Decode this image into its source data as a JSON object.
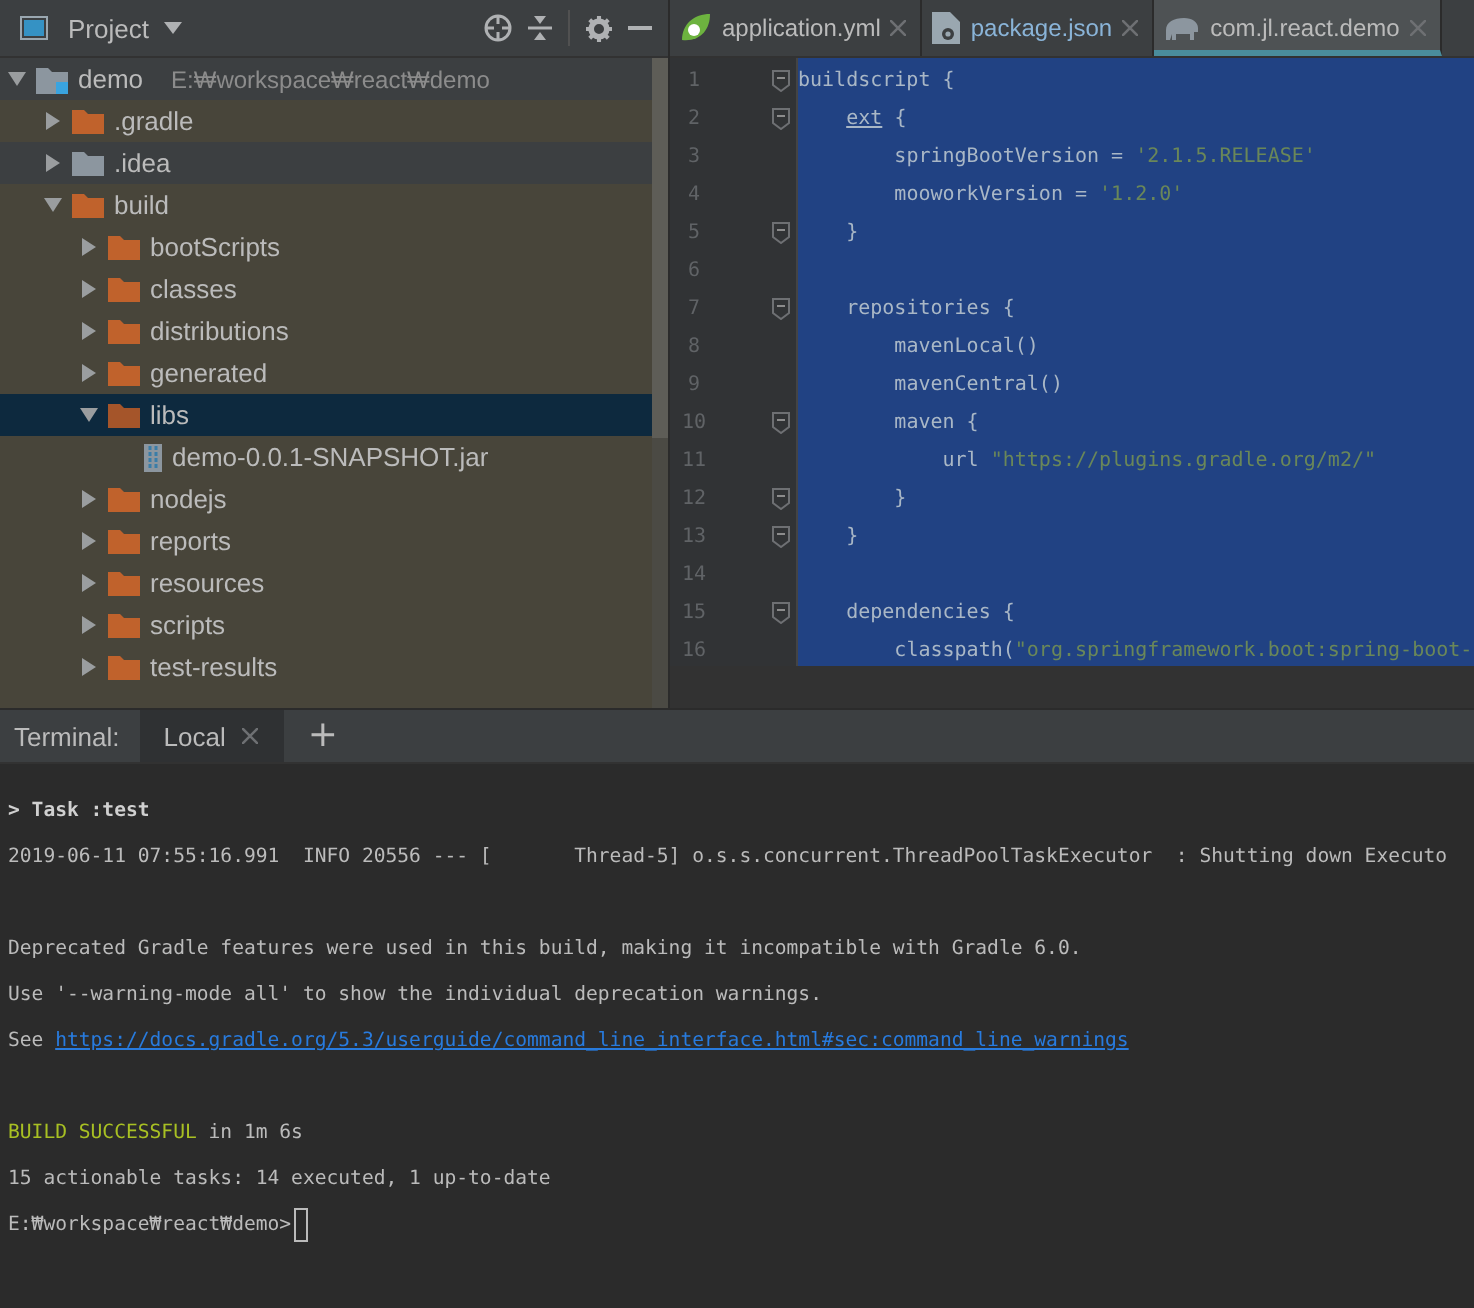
{
  "project": {
    "title": "Project",
    "tree": [
      {
        "name": "demo",
        "path": "E:₩workspace₩react₩demo",
        "kind": "module",
        "expanded": true,
        "excluded": false,
        "selected": false,
        "children": [
          {
            "name": ".gradle",
            "kind": "folder",
            "expanded": false,
            "excluded": true,
            "selected": false
          },
          {
            "name": ".idea",
            "kind": "folder",
            "expanded": false,
            "excluded": false,
            "selected": false
          },
          {
            "name": "build",
            "kind": "folder",
            "expanded": true,
            "excluded": true,
            "selected": false,
            "children": [
              {
                "name": "bootScripts",
                "kind": "folder",
                "expanded": false,
                "excluded": true,
                "selected": false
              },
              {
                "name": "classes",
                "kind": "folder",
                "expanded": false,
                "excluded": true,
                "selected": false
              },
              {
                "name": "distributions",
                "kind": "folder",
                "expanded": false,
                "excluded": true,
                "selected": false
              },
              {
                "name": "generated",
                "kind": "folder",
                "expanded": false,
                "excluded": true,
                "selected": false
              },
              {
                "name": "libs",
                "kind": "folder",
                "expanded": true,
                "excluded": true,
                "selected": true,
                "children": [
                  {
                    "name": "demo-0.0.1-SNAPSHOT.jar",
                    "kind": "jar",
                    "excluded": true,
                    "selected": false
                  }
                ]
              },
              {
                "name": "nodejs",
                "kind": "folder",
                "expanded": false,
                "excluded": true,
                "selected": false
              },
              {
                "name": "reports",
                "kind": "folder",
                "expanded": false,
                "excluded": true,
                "selected": false
              },
              {
                "name": "resources",
                "kind": "folder",
                "expanded": false,
                "excluded": true,
                "selected": false
              },
              {
                "name": "scripts",
                "kind": "folder",
                "expanded": false,
                "excluded": true,
                "selected": false
              },
              {
                "name": "test-results",
                "kind": "folder",
                "expanded": false,
                "excluded": true,
                "selected": false
              }
            ]
          }
        ]
      }
    ]
  },
  "editor": {
    "tabs": [
      {
        "label": "application.yml",
        "kind": "spring",
        "selected": false
      },
      {
        "label": "package.json",
        "kind": "file",
        "selected": false
      },
      {
        "label": "com.jl.react.demo",
        "kind": "gradle",
        "selected": true
      }
    ],
    "lines": [
      {
        "number": "1",
        "fold": true,
        "segments": [
          {
            "kind": "plain",
            "text": "buildscript {"
          }
        ]
      },
      {
        "number": "2",
        "fold": true,
        "segments": [
          {
            "kind": "link",
            "text": "    ext"
          },
          {
            "kind": "plain",
            "text": " {"
          }
        ]
      },
      {
        "number": "3",
        "fold": false,
        "segments": [
          {
            "kind": "plain",
            "text": "        springBootVersion = "
          },
          {
            "kind": "string",
            "text": "'2.1.5.RELEASE'"
          }
        ]
      },
      {
        "number": "4",
        "fold": false,
        "segments": [
          {
            "kind": "plain",
            "text": "        mooworkVersion = "
          },
          {
            "kind": "string",
            "text": "'1.2.0'"
          }
        ]
      },
      {
        "number": "5",
        "fold": true,
        "segments": [
          {
            "kind": "plain",
            "text": "    }"
          }
        ]
      },
      {
        "number": "6",
        "fold": false
      },
      {
        "number": "7",
        "fold": true,
        "segments": [
          {
            "kind": "plain",
            "text": "    repositories {"
          }
        ]
      },
      {
        "number": "8",
        "fold": false,
        "segments": [
          {
            "kind": "plain",
            "text": "        mavenLocal()"
          }
        ]
      },
      {
        "number": "9",
        "fold": false,
        "segments": [
          {
            "kind": "plain",
            "text": "        mavenCentral()"
          }
        ]
      },
      {
        "number": "10",
        "fold": true,
        "segments": [
          {
            "kind": "plain",
            "text": "        maven {"
          }
        ]
      },
      {
        "number": "11",
        "fold": false,
        "segments": [
          {
            "kind": "plain",
            "text": "            url "
          },
          {
            "kind": "string",
            "text": "\"https://plugins.gradle.org/m2/\""
          }
        ]
      },
      {
        "number": "12",
        "fold": true,
        "segments": [
          {
            "kind": "plain",
            "text": "        }"
          }
        ]
      },
      {
        "number": "13",
        "fold": true,
        "segments": [
          {
            "kind": "plain",
            "text": "    }"
          }
        ]
      },
      {
        "number": "14",
        "fold": false
      },
      {
        "number": "15",
        "fold": true,
        "segments": [
          {
            "kind": "plain",
            "text": "    dependencies {"
          }
        ]
      },
      {
        "number": "16",
        "fold": false,
        "segments": [
          {
            "kind": "plain",
            "text": "        classpath("
          },
          {
            "kind": "string",
            "text": "\"org.springframework.boot:spring-boot-"
          }
        ]
      }
    ]
  },
  "terminal": {
    "label": "Terminal:",
    "tabs": [
      {
        "label": "Local",
        "selected": true
      }
    ],
    "add": "+",
    "blocks": [
      [
        [
          {
            "kind": "bold",
            "text": "> Task :test"
          }
        ],
        [
          {
            "kind": "plain",
            "text": "2019-06-11 07:55:16.991  INFO 20556 --- [       Thread-5] o.s.s.concurrent.ThreadPoolTaskExecutor  : Shutting down Executo"
          }
        ]
      ],
      [
        [
          {
            "kind": "plain",
            "text": "Deprecated Gradle features were used in this build, making it incompatible with Gradle 6.0."
          }
        ],
        [
          {
            "kind": "plain",
            "text": "Use '--warning-mode all' to show the individual deprecation warnings."
          }
        ],
        [
          {
            "kind": "plain",
            "text": "See "
          },
          {
            "kind": "link",
            "text": "https://docs.gradle.org/5.3/userguide/command_line_interface.html#sec:command_line_warnings"
          }
        ]
      ],
      [
        [
          {
            "kind": "success",
            "text": "BUILD SUCCESSFUL"
          },
          {
            "kind": "plain",
            "text": " in 1m 6s"
          }
        ],
        [
          {
            "kind": "plain",
            "text": "15 actionable tasks: 14 executed, 1 up-to-date"
          }
        ],
        [
          {
            "kind": "plain",
            "text": "E:₩workspace₩react₩demo>"
          },
          {
            "kind": "cursor"
          }
        ]
      ]
    ]
  }
}
